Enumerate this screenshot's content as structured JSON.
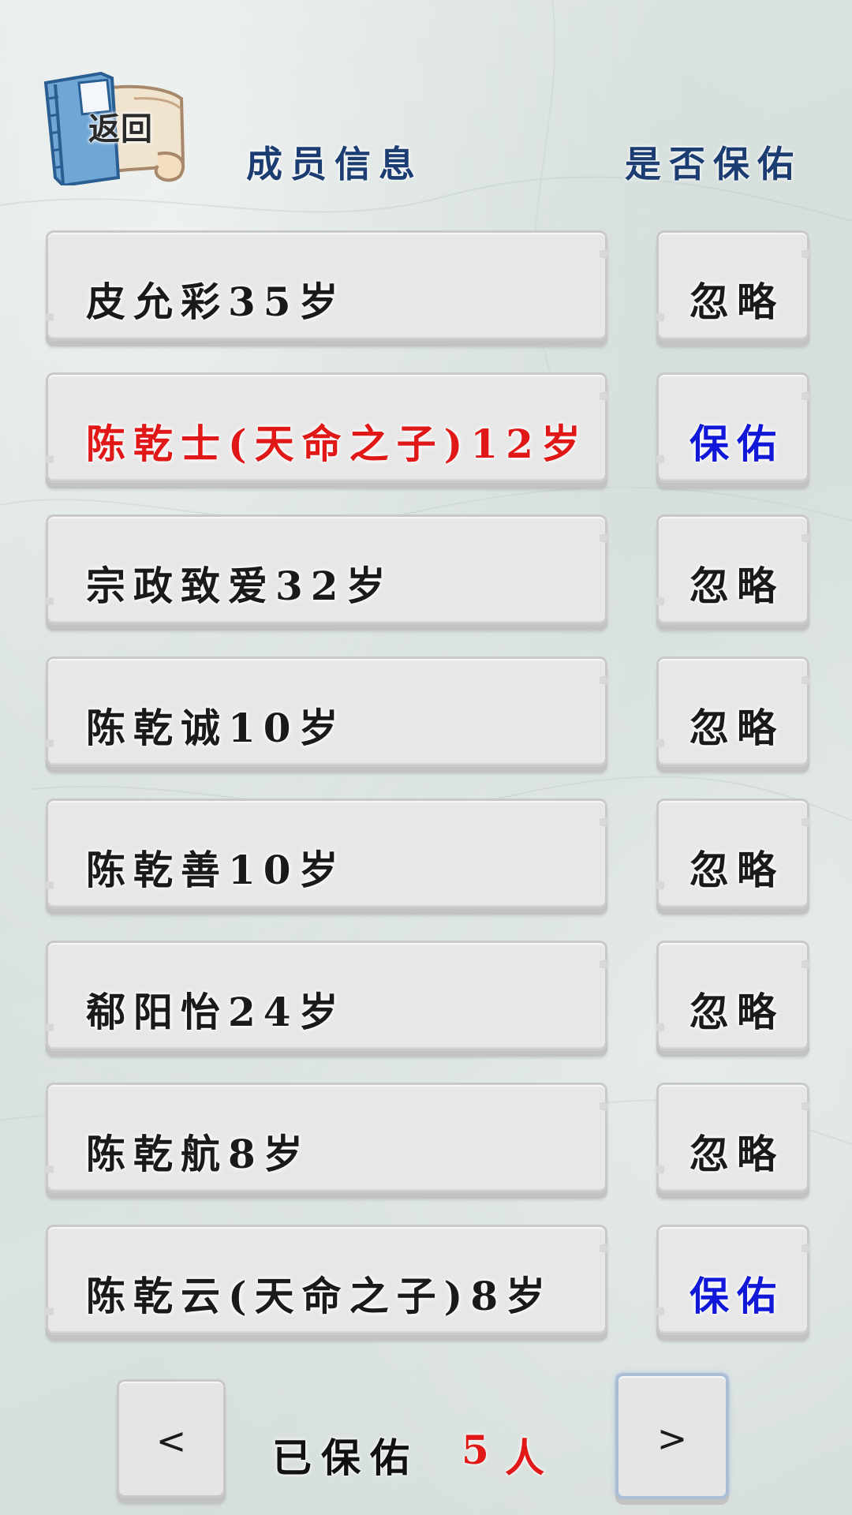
{
  "header": {
    "back_label": "返回",
    "member_info": "成员信息",
    "protect_status": "是否保佑"
  },
  "colors": {
    "header": "#1b3d72",
    "normal_text": "#1a1a1a",
    "chosen_name": "#e01818",
    "protect_action": "#1218d8",
    "count": "#e01818"
  },
  "members": [
    {
      "name": "皮允彩35岁",
      "action": "忽略",
      "highlight": false
    },
    {
      "name": "陈乾士(天命之子)12岁",
      "action": "保佑",
      "highlight": true
    },
    {
      "name": "宗政致爱32岁",
      "action": "忽略",
      "highlight": false
    },
    {
      "name": "陈乾诚10岁",
      "action": "忽略",
      "highlight": false
    },
    {
      "name": "陈乾善10岁",
      "action": "忽略",
      "highlight": false
    },
    {
      "name": "郗阳怡24岁",
      "action": "忽略",
      "highlight": false
    },
    {
      "name": "陈乾航8岁",
      "action": "忽略",
      "highlight": false
    },
    {
      "name": "陈乾云(天命之子)8岁",
      "action": "保佑",
      "highlight": false
    }
  ],
  "footer": {
    "prev": "<",
    "next": ">",
    "label": "已保佑",
    "count": "5",
    "unit": "人"
  },
  "icons": {
    "back": "book-scroll-icon"
  }
}
